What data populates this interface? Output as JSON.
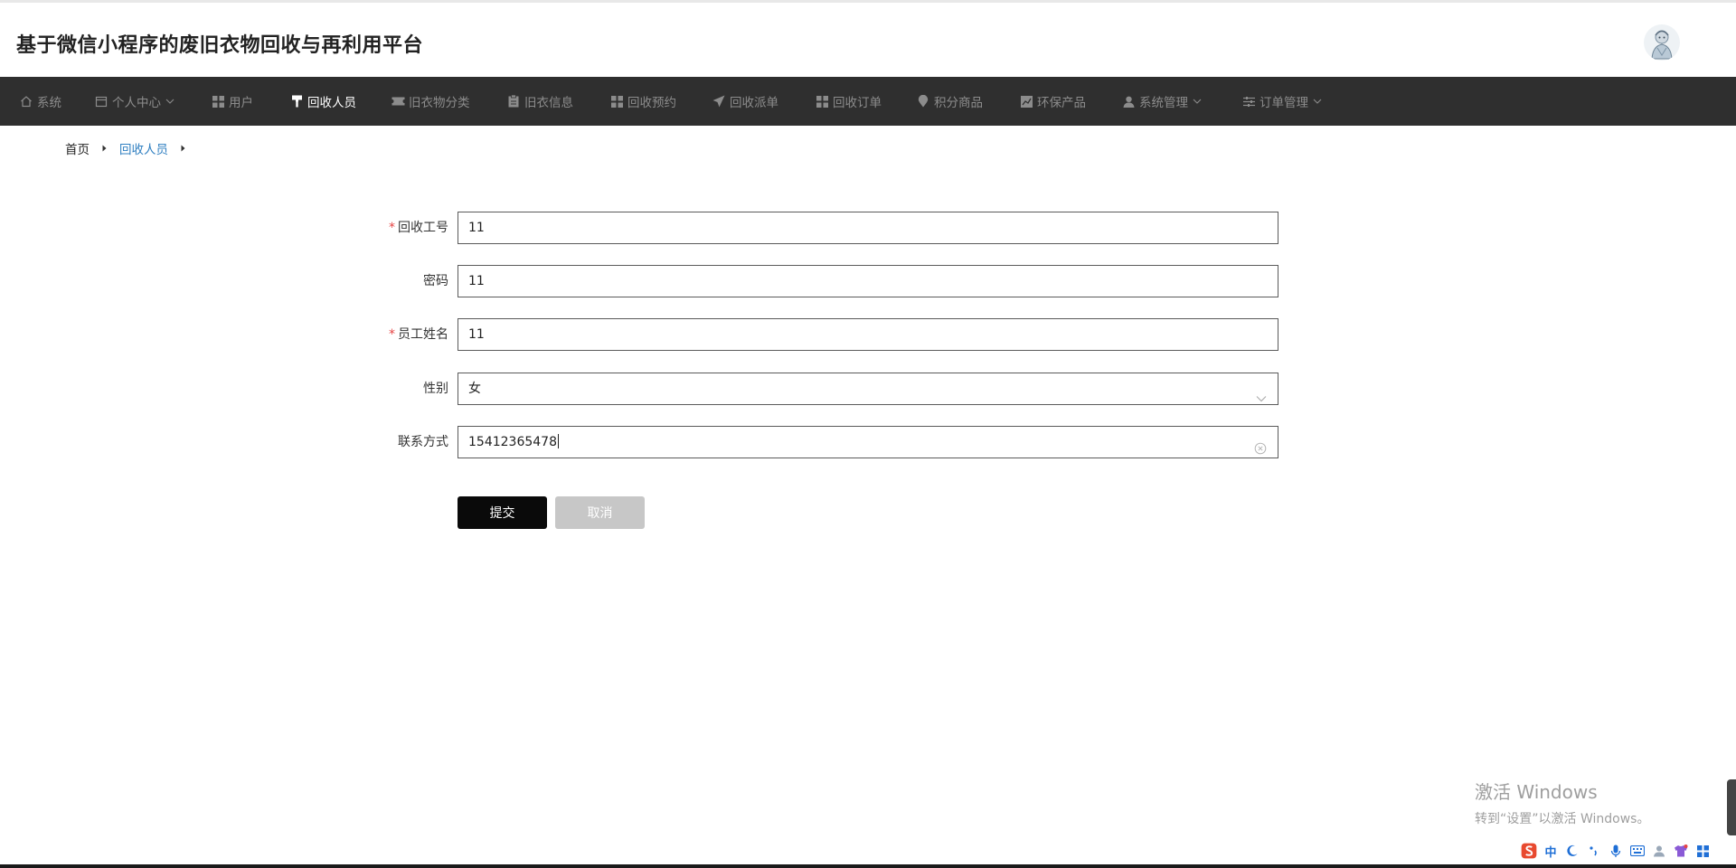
{
  "app": {
    "title": "基于微信小程序的废旧衣物回收与再利用平台"
  },
  "nav": {
    "items": [
      {
        "label": "系统",
        "icon": "home-icon",
        "active": false
      },
      {
        "label": "个人中心",
        "icon": "calendar-icon",
        "active": false,
        "dropdown": true
      },
      {
        "label": "用户",
        "icon": "grid-icon",
        "active": false
      },
      {
        "label": "回收人员",
        "icon": "paint-roller-icon",
        "active": true
      },
      {
        "label": "旧衣物分类",
        "icon": "ticket-icon",
        "active": false
      },
      {
        "label": "旧衣信息",
        "icon": "clipboard-icon",
        "active": false
      },
      {
        "label": "回收预约",
        "icon": "grid-icon",
        "active": false
      },
      {
        "label": "回收派单",
        "icon": "send-icon",
        "active": false
      },
      {
        "label": "回收订单",
        "icon": "grid-icon",
        "active": false
      },
      {
        "label": "积分商品",
        "icon": "location-pin-icon",
        "active": false
      },
      {
        "label": "环保产品",
        "icon": "chart-icon",
        "active": false
      },
      {
        "label": "系统管理",
        "icon": "user-icon",
        "active": false,
        "dropdown": true
      },
      {
        "label": "订单管理",
        "icon": "sliders-icon",
        "active": false,
        "dropdown": true
      }
    ]
  },
  "breadcrumb": {
    "home": "首页",
    "current": "回收人员"
  },
  "form": {
    "staff_id": {
      "label": "回收工号",
      "value": "11",
      "required": true
    },
    "password": {
      "label": "密码",
      "value": "11",
      "required": false
    },
    "staff_name": {
      "label": "员工姓名",
      "value": "11",
      "required": true
    },
    "gender": {
      "label": "性别",
      "value": "女",
      "required": false
    },
    "contact": {
      "label": "联系方式",
      "value": "15412365478",
      "required": false
    }
  },
  "buttons": {
    "submit": "提交",
    "cancel": "取消"
  },
  "watermark": {
    "line1": "激活 Windows",
    "line2": "转到“设置”以激活 Windows。"
  },
  "taskbar": {
    "ime_label": "中"
  },
  "colors": {
    "nav_bg": "#2f2f2f",
    "nav_text": "#8c8c8c",
    "nav_active": "#ffffff",
    "breadcrumb_active": "#2f7fc1",
    "submit_bg": "#0a0a0a",
    "cancel_bg": "#c7c7c7",
    "required_mark": "#e64545"
  }
}
